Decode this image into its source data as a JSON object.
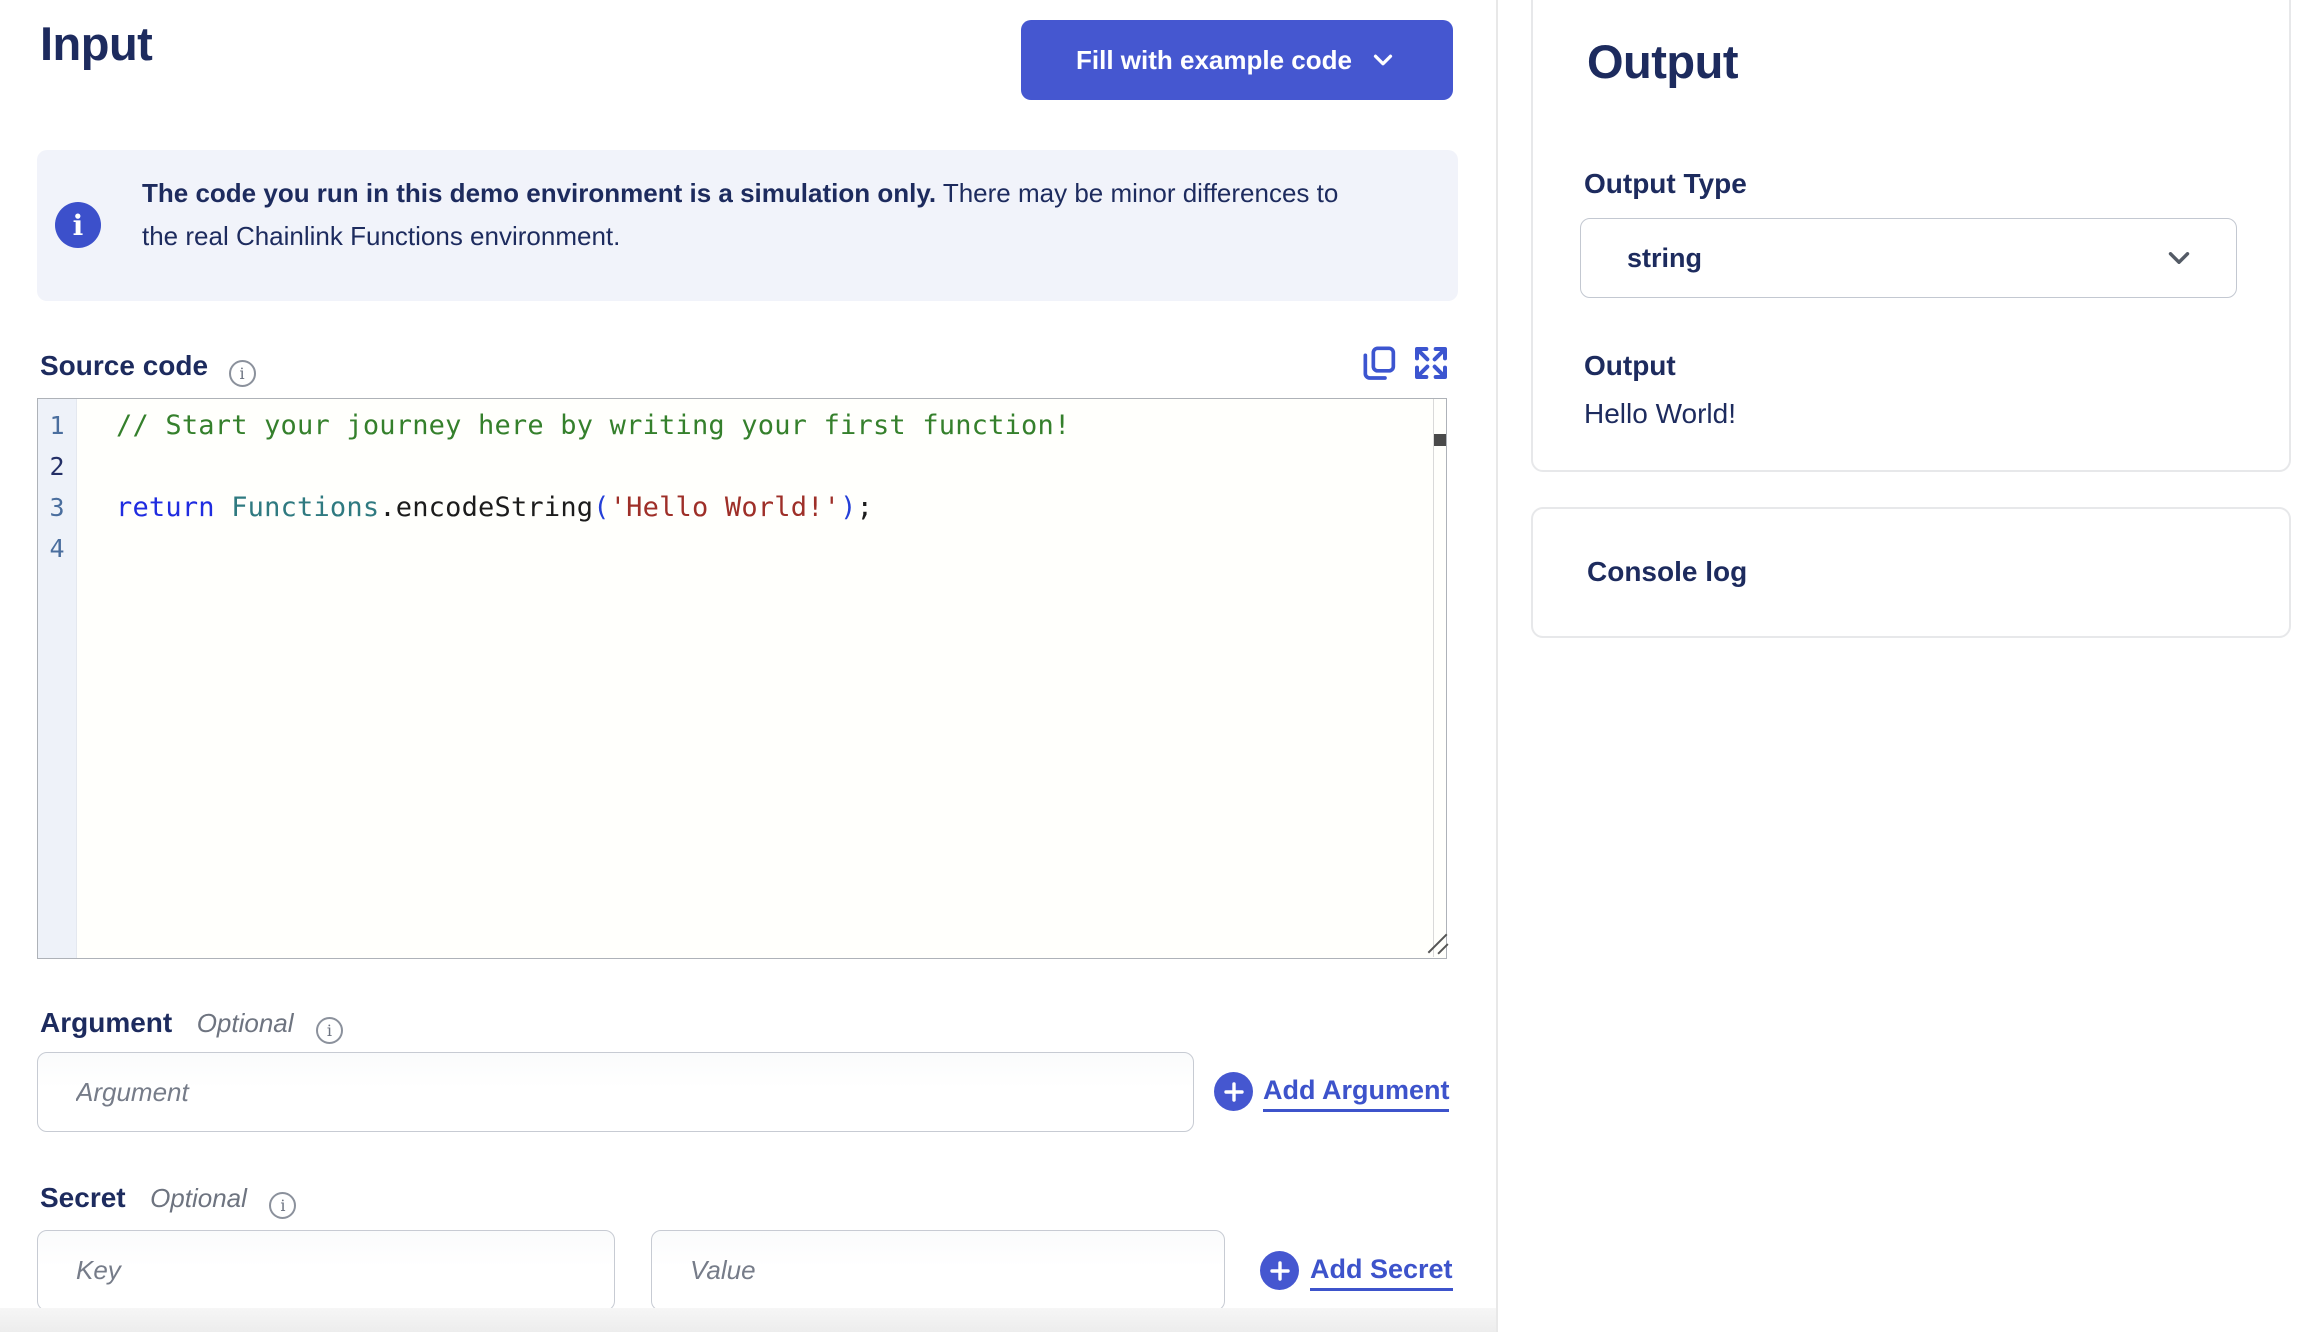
{
  "input_panel": {
    "title": "Input",
    "fill_button_label": "Fill with example code",
    "notice": {
      "line1_bold": "The code you run in this demo environment is a simulation only.",
      "line1_rest": " There may be minor differences to",
      "line2": "the real Chainlink Functions environment."
    },
    "source_code": {
      "label": "Source code",
      "lines": [
        {
          "num": "1",
          "tokens": [
            {
              "t": "// Start your journey here by writing your first function!",
              "c": "comment"
            }
          ]
        },
        {
          "num": "2",
          "active": true,
          "tokens": []
        },
        {
          "num": "3",
          "tokens": [
            {
              "t": "return",
              "c": "keyword"
            },
            {
              "t": " ",
              "c": "plain"
            },
            {
              "t": "Functions",
              "c": "type"
            },
            {
              "t": ".encodeString",
              "c": "plain"
            },
            {
              "t": "(",
              "c": "paren"
            },
            {
              "t": "'Hello World!'",
              "c": "string"
            },
            {
              "t": ")",
              "c": "paren"
            },
            {
              "t": ";",
              "c": "plain"
            }
          ]
        },
        {
          "num": "4",
          "tokens": []
        }
      ]
    },
    "argument": {
      "label": "Argument",
      "optional": "Optional",
      "placeholder": "Argument",
      "add_label": "Add Argument"
    },
    "secret": {
      "label": "Secret",
      "optional": "Optional",
      "key_placeholder": "Key",
      "value_placeholder": "Value",
      "add_label": "Add Secret"
    }
  },
  "output_panel": {
    "title": "Output",
    "output_type_label": "Output Type",
    "output_type_value": "string",
    "output_label": "Output",
    "output_value": "Hello World!",
    "console_label": "Console log"
  },
  "colors": {
    "brand_blue": "#4557d0",
    "link_blue": "#3d53cb",
    "navy": "#1d2b5e",
    "banner_bg": "#f1f3fa",
    "code_comment": "#35802c",
    "code_keyword": "#1f2ce0",
    "code_type": "#2f7a80",
    "code_string": "#9e2f28"
  }
}
